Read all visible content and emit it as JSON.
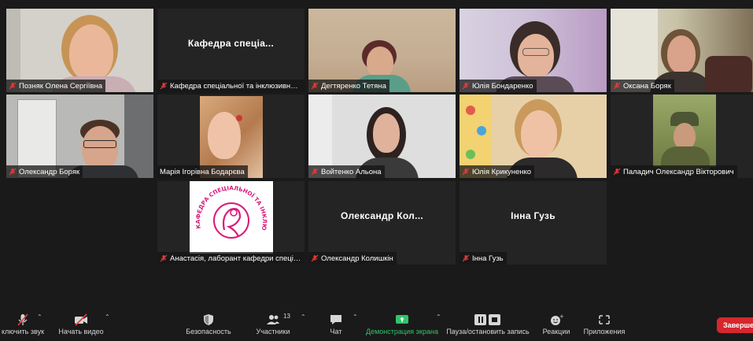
{
  "tiles": [
    {
      "name": "Позняк Олена Сергіївна",
      "type": "video",
      "bg": "#d3d0c8"
    },
    {
      "name": "Кафедра спеціальної та інклюзивної ...",
      "center": "Кафедра  спеціа...",
      "type": "text"
    },
    {
      "name": "Дегтяренко Тетяна",
      "type": "video",
      "bg": "#c9b29a"
    },
    {
      "name": "Юлія Бондаренко",
      "type": "video",
      "bg": "#d9c8de"
    },
    {
      "name": "Оксана Боряк",
      "type": "video",
      "bg": "#cfc9b6"
    },
    {
      "name": "Олександр Боряк",
      "type": "video",
      "bg": "#b8b8b6"
    },
    {
      "name": "Марія Ігорівна Бодарєва",
      "type": "video",
      "bg": "#c79a6c",
      "active": true
    },
    {
      "name": "Войтенко Альона",
      "type": "video",
      "bg": "#dcdcdc"
    },
    {
      "name": "Юлія Крикуненко",
      "type": "video",
      "bg": "#e5c8a0"
    },
    {
      "name": "Паладич Олександр Вікторович",
      "type": "video",
      "bg": "#7c8a4a"
    },
    {
      "name": "Анастасія, лаборант кафедри спеціа...",
      "type": "logo",
      "logo_text": "КАФЕДРА СПЕЦІАЛЬНОЇ ТА ІНКЛЮЗИВНОЇ ОСВІТИ"
    },
    {
      "name": "Олександр Колишкін",
      "center": "Олександр  Кол...",
      "type": "text"
    },
    {
      "name": "Інна Гузь",
      "center": "Інна Гузь",
      "type": "text"
    }
  ],
  "toolbar": {
    "mute_label": "ключить звук",
    "video_label": "Начать видео",
    "security_label": "Безопасность",
    "participants_label": "Участники",
    "participants_count": "13",
    "chat_label": "Чат",
    "share_label": "Демонстрация экрана",
    "record_label": "Пауза/остановить запись",
    "reactions_label": "Реакции",
    "apps_label": "Приложения",
    "end_label": "Завершен"
  },
  "colors": {
    "active_border": "#e8e36a",
    "share_green": "#2fc46b",
    "end_red": "#d6262d",
    "logo_magenta": "#d81b7a"
  }
}
